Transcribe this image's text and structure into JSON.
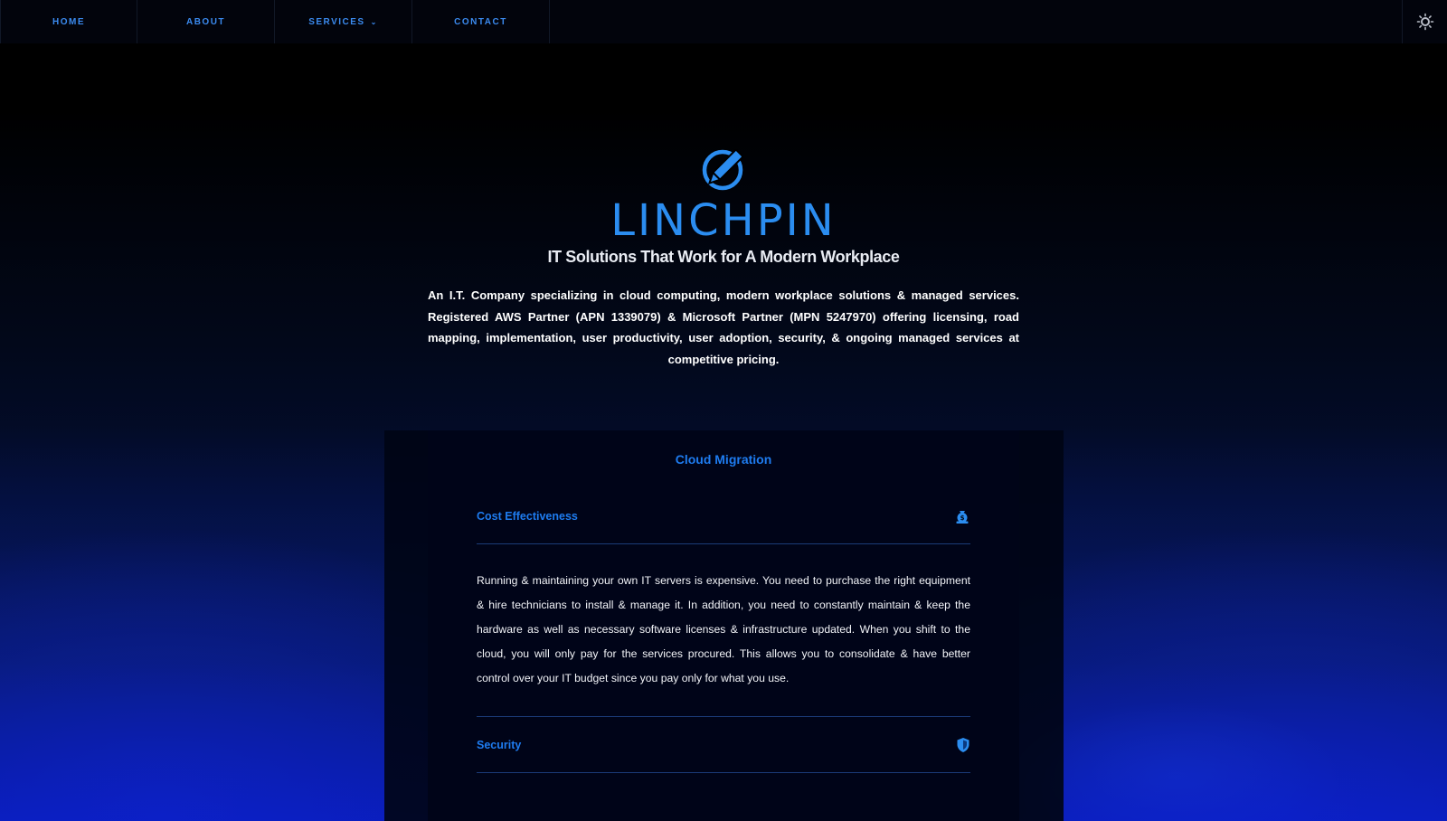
{
  "nav": {
    "items": [
      {
        "label": "HOME"
      },
      {
        "label": "ABOUT"
      },
      {
        "label": "SERVICES",
        "has_dropdown": true
      },
      {
        "label": "CONTACT"
      }
    ],
    "theme_toggle_icon": "sun-icon"
  },
  "hero": {
    "logo_icon": "pencil-circle-logo-icon",
    "brand": "LINCHPIN",
    "tagline": "IT Solutions That Work for A Modern Workplace",
    "intro": "An I.T. Company specializing in cloud computing, modern workplace solutions & managed services. Registered AWS Partner (APN 1339079) & Microsoft Partner (MPN 5247970) offering licensing, road mapping, implementation, user productivity, user adoption, security, & ongoing managed services at competitive pricing."
  },
  "services_panel": {
    "title": "Cloud Migration",
    "accordion": [
      {
        "label": "Cost Effectiveness",
        "icon": "money-bag-icon",
        "expanded": true,
        "body": "Running & maintaining your own IT servers is expensive. You need to purchase the right equipment & hire technicians to install & manage it. In addition, you need to constantly maintain & keep the hardware as well as necessary software licenses & infrastructure updated. When you shift to the cloud, you will only pay for the services procured. This allows you to consolidate & have better control over your IT budget since you pay only for what you use."
      },
      {
        "label": "Security",
        "icon": "shield-icon",
        "expanded": false
      }
    ]
  },
  "colors": {
    "accent": "#1e7cf0",
    "background": "#000000",
    "text": "#ffffff"
  }
}
